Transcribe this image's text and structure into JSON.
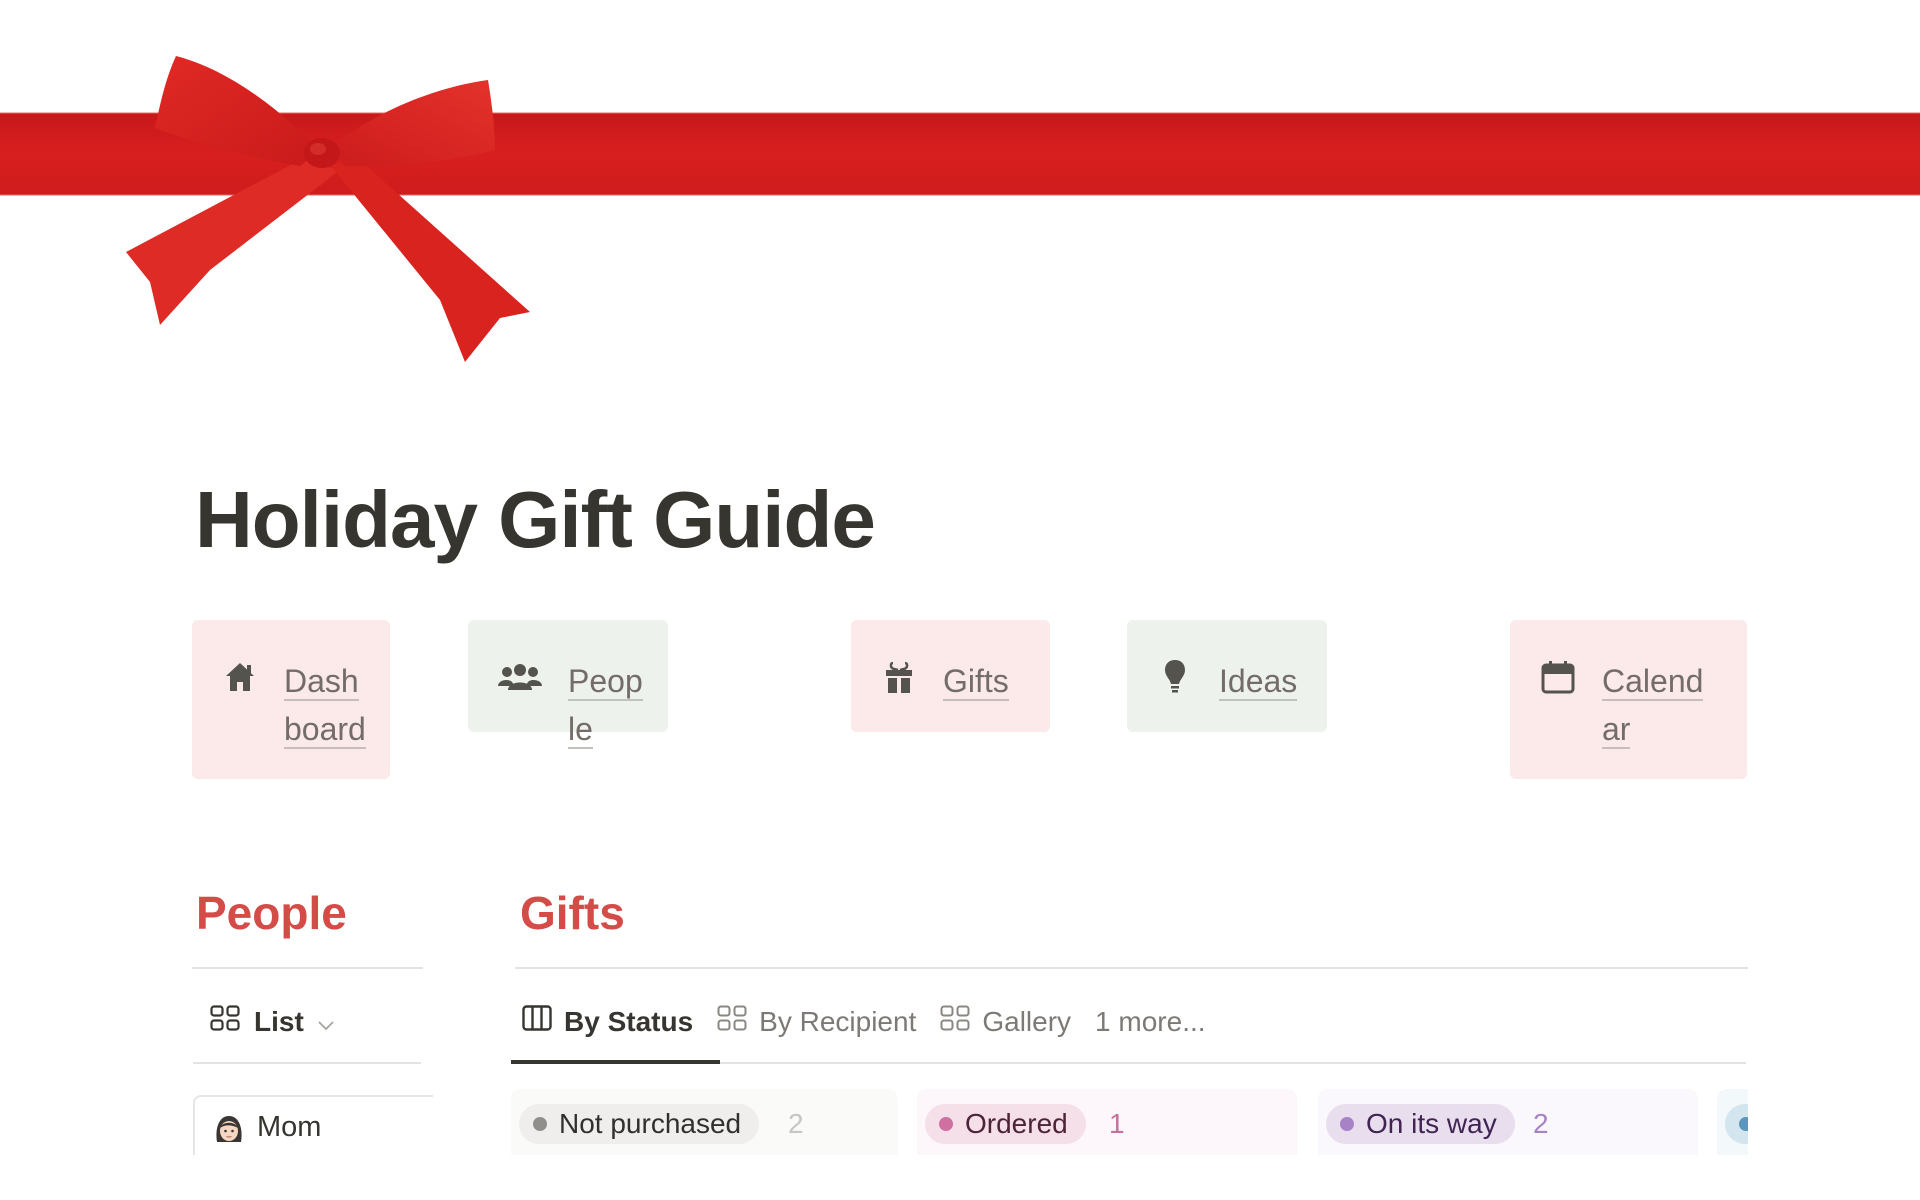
{
  "page": {
    "title": "Holiday Gift Guide",
    "cover": {
      "description": "red-ribbon-with-bow",
      "ribbon_color": "#d81f1f"
    }
  },
  "nav_cards": [
    {
      "label": "Dashboard",
      "icon": "home-icon",
      "bg": "#fce9e9"
    },
    {
      "label": "People",
      "icon": "people-icon",
      "bg": "#edf2ec"
    },
    {
      "label": "Gifts",
      "icon": "gift-icon",
      "bg": "#fce9e9"
    },
    {
      "label": "Ideas",
      "icon": "lightbulb-icon",
      "bg": "#edf2ec"
    },
    {
      "label": "Calendar",
      "icon": "calendar-icon",
      "bg": "#fce9e9"
    }
  ],
  "people_section": {
    "heading": "People",
    "view": {
      "label": "List",
      "icon": "gallery-grid-icon"
    },
    "items": [
      {
        "name": "Mom",
        "icon": "woman-emoji"
      }
    ]
  },
  "gifts_section": {
    "heading": "Gifts",
    "tabs": [
      {
        "label": "By Status",
        "icon": "board-columns-icon",
        "active": true
      },
      {
        "label": "By Recipient",
        "icon": "gallery-grid-icon",
        "active": false
      },
      {
        "label": "Gallery",
        "icon": "gallery-grid-icon",
        "active": false
      },
      {
        "label": "1 more...",
        "icon": "",
        "active": false
      }
    ],
    "board_columns": [
      {
        "status": "Not purchased",
        "count": "2",
        "col_bg": "#fafaf9",
        "pill_bg": "#efeeed",
        "dot": "#918f8b",
        "text": "#32302c",
        "count_color": "#c7c6c3"
      },
      {
        "status": "Ordered",
        "count": "1",
        "col_bg": "#fdf6fa",
        "pill_bg": "#f5e0ea",
        "dot": "#d070a0",
        "text": "#4c2337",
        "count_color": "#c5729c"
      },
      {
        "status": "On its way",
        "count": "2",
        "col_bg": "#faf8fc",
        "pill_bg": "#e8deee",
        "dot": "#a783c6",
        "text": "#412454",
        "count_color": "#a783c6"
      },
      {
        "status": "",
        "count": "",
        "col_bg": "#f3f8fb",
        "pill_bg": "#d3e5ef",
        "dot": "#5b97bd",
        "text": "#183347",
        "count_color": "#5b97bd"
      }
    ]
  }
}
